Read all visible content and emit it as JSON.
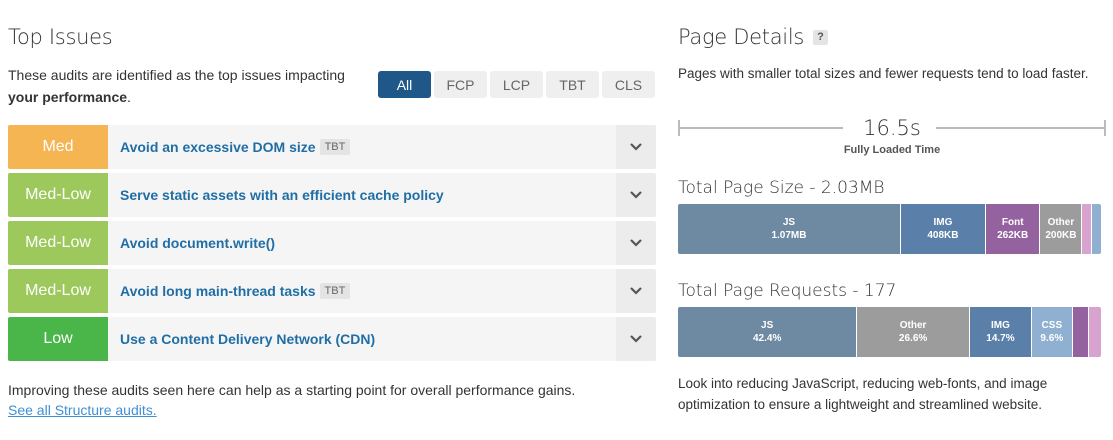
{
  "top_issues": {
    "title": "Top Issues",
    "intro_text": "These audits are identified as the top issues impacting ",
    "intro_bold": "your performance",
    "intro_end": ".",
    "filters": [
      "All",
      "FCP",
      "LCP",
      "TBT",
      "CLS"
    ],
    "active_filter": "All",
    "items": [
      {
        "severity": "Med",
        "color": "#f5b553",
        "label": "Avoid an excessive DOM size",
        "tag": "TBT"
      },
      {
        "severity": "Med-Low",
        "color": "#9dc85b",
        "label": "Serve static assets with an efficient cache policy",
        "tag": ""
      },
      {
        "severity": "Med-Low",
        "color": "#9dc85b",
        "label": "Avoid document.write()",
        "tag": ""
      },
      {
        "severity": "Med-Low",
        "color": "#9dc85b",
        "label": "Avoid long main-thread tasks",
        "tag": "TBT"
      },
      {
        "severity": "Low",
        "color": "#4ab548",
        "label": "Use a Content Delivery Network (CDN)",
        "tag": ""
      }
    ],
    "bottom_note": "Improving these audits seen here can help as a starting point for overall performance gains.",
    "see_all_link": "See all Structure audits."
  },
  "page_details": {
    "title": "Page Details",
    "help_icon": "?",
    "description": "Pages with smaller total sizes and fewer requests tend to load faster.",
    "fully_loaded_value": "16.5s",
    "fully_loaded_label": "Fully Loaded Time",
    "size_title": "Total Page Size - 2.03MB",
    "size_segments": [
      {
        "name": "JS",
        "value": "1.07MB",
        "share": 52.7,
        "color": "#6e8aa3"
      },
      {
        "name": "IMG",
        "value": "408KB",
        "share": 20.1,
        "color": "#5a7fa8"
      },
      {
        "name": "Font",
        "value": "262KB",
        "share": 12.9,
        "color": "#9562a0"
      },
      {
        "name": "Other",
        "value": "200KB",
        "share": 9.9,
        "color": "#9c9c9c"
      },
      {
        "name": "",
        "value": "",
        "share": 2.3,
        "color": "#d9a3cf"
      },
      {
        "name": "",
        "value": "",
        "share": 2.1,
        "color": "#8fb0d0"
      }
    ],
    "requests_title": "Total Page Requests - 177",
    "request_segments": [
      {
        "name": "JS",
        "value": "42.4%",
        "share": 42.4,
        "color": "#6e8aa3"
      },
      {
        "name": "Other",
        "value": "26.6%",
        "share": 26.6,
        "color": "#9c9c9c"
      },
      {
        "name": "IMG",
        "value": "14.7%",
        "share": 14.7,
        "color": "#5a7fa8"
      },
      {
        "name": "CSS",
        "value": "9.6%",
        "share": 9.6,
        "color": "#8fb0d0"
      },
      {
        "name": "",
        "value": "",
        "share": 3.9,
        "color": "#9562a0"
      },
      {
        "name": "",
        "value": "",
        "share": 2.8,
        "color": "#d9a3cf"
      }
    ],
    "footer": "Look into reducing JavaScript, reducing web-fonts, and image optimization to ensure a lightweight and streamlined website."
  }
}
